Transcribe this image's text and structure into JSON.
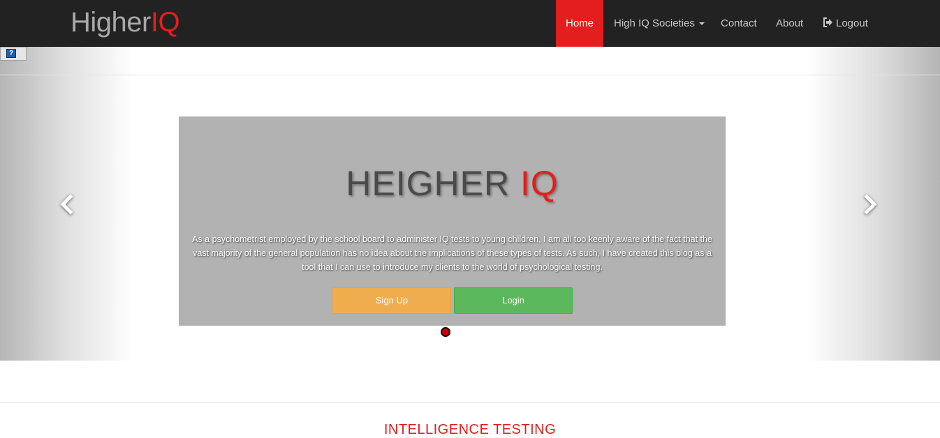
{
  "navbar": {
    "brand": {
      "part1": "Higher",
      "part2": "IQ"
    },
    "items": [
      {
        "label": "Home",
        "active": true
      },
      {
        "label": "High IQ Societies",
        "dropdown": true
      },
      {
        "label": "Contact"
      },
      {
        "label": "About"
      },
      {
        "label": "Logout",
        "icon": "logout-icon"
      }
    ]
  },
  "help": {
    "label": "?"
  },
  "hero": {
    "title_part1": "HEIGHER ",
    "title_part2": "IQ",
    "text": "As a psychometrist employed by the school board to administer IQ tests to young children, I am all too keenly aware of the fact that the vast majority of the general population has no idea about the implications of these types of tests. As such, I have created this blog as a tool that I can use to introduce my clients to the world of psychological testing.",
    "signup_label": "Sign Up",
    "login_label": "Login"
  },
  "section": {
    "heading": "INTELLIGENCE TESTING"
  },
  "colors": {
    "accent": "#e41e1e",
    "navbar": "#222222",
    "panel": "#b2b2b2",
    "signup": "#f0ad4e",
    "login": "#5cb85c"
  }
}
